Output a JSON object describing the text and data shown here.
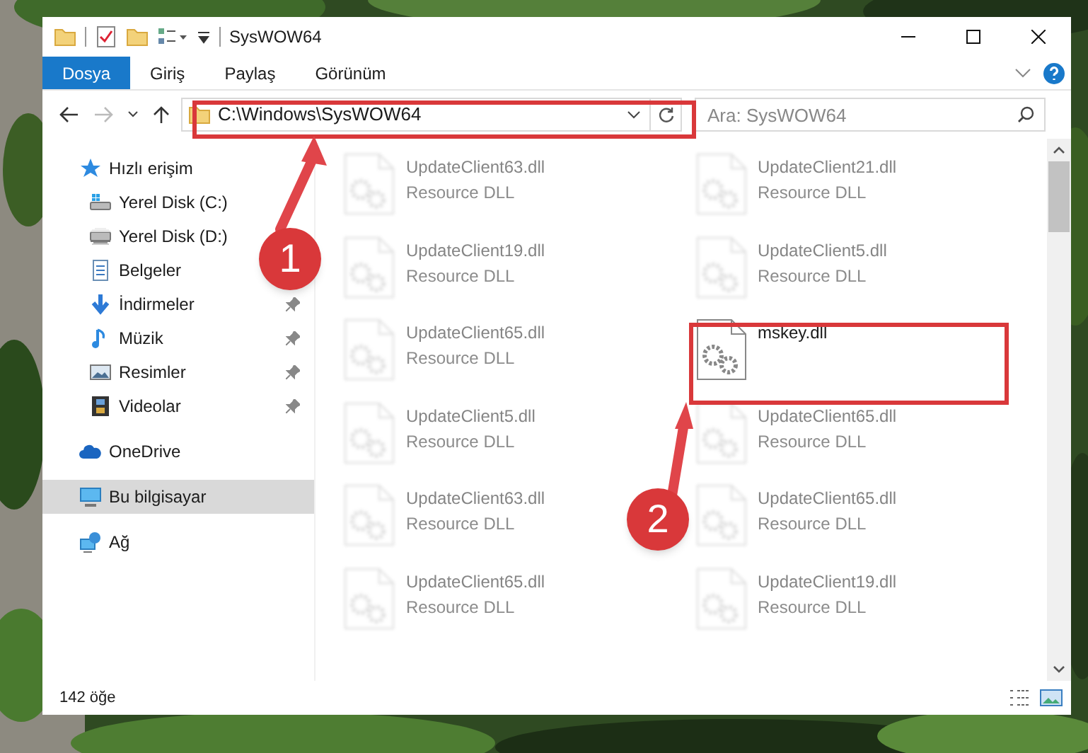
{
  "window": {
    "title": "SysWOW64"
  },
  "ribbon": {
    "tabs": [
      {
        "label": "Dosya",
        "selected": true
      },
      {
        "label": "Giriş",
        "selected": false
      },
      {
        "label": "Paylaş",
        "selected": false
      },
      {
        "label": "Görünüm",
        "selected": false
      }
    ]
  },
  "address_bar": {
    "path": "C:\\Windows\\SysWOW64"
  },
  "search": {
    "placeholder": "Ara: SysWOW64"
  },
  "navigation_pane": [
    {
      "label": "Hızlı erişim",
      "kind": "quick-access",
      "selected": false,
      "children": [
        {
          "label": "Yerel Disk (C:)",
          "kind": "system-drive",
          "pinned": false,
          "selected": false
        },
        {
          "label": "Yerel Disk (D:)",
          "kind": "drive",
          "pinned": false,
          "selected": false
        },
        {
          "label": "Belgeler",
          "kind": "documents",
          "pinned": false,
          "selected": false
        },
        {
          "label": "İndirmeler",
          "kind": "downloads",
          "pinned": true,
          "selected": false
        },
        {
          "label": "Müzik",
          "kind": "music",
          "pinned": true,
          "selected": false
        },
        {
          "label": "Resimler",
          "kind": "pictures",
          "pinned": true,
          "selected": false
        },
        {
          "label": "Videolar",
          "kind": "videos",
          "pinned": true,
          "selected": false
        }
      ]
    },
    {
      "label": "OneDrive",
      "kind": "cloud",
      "selected": false
    },
    {
      "label": "Bu bilgisayar",
      "kind": "computer",
      "selected": true
    },
    {
      "label": "Ağ",
      "kind": "network",
      "selected": false
    }
  ],
  "files": [
    {
      "name": "UpdateClient63.dll",
      "type": "Resource DLL",
      "faded": true
    },
    {
      "name": "UpdateClient21.dll",
      "type": "Resource DLL",
      "faded": true
    },
    {
      "name": "UpdateClient19.dll",
      "type": "Resource DLL",
      "faded": true
    },
    {
      "name": "UpdateClient5.dll",
      "type": "Resource DLL",
      "faded": true
    },
    {
      "name": "UpdateClient65.dll",
      "type": "Resource DLL",
      "faded": true
    },
    {
      "name": "mskey.dll",
      "faded": false
    },
    {
      "name": "UpdateClient5.dll",
      "type": "Resource DLL",
      "faded": true
    },
    {
      "name": "UpdateClient65.dll",
      "type": "Resource DLL",
      "faded": true
    },
    {
      "name": "UpdateClient63.dll",
      "type": "Resource DLL",
      "faded": true
    },
    {
      "name": "UpdateClient65.dll",
      "type": "Resource DLL",
      "faded": true
    },
    {
      "name": "UpdateClient65.dll",
      "type": "Resource DLL",
      "faded": true
    },
    {
      "name": "UpdateClient19.dll",
      "type": "Resource DLL",
      "faded": true
    }
  ],
  "status_bar": {
    "item_count": "142 öğe"
  },
  "annotations": [
    {
      "label": "1"
    },
    {
      "label": "2"
    }
  ]
}
